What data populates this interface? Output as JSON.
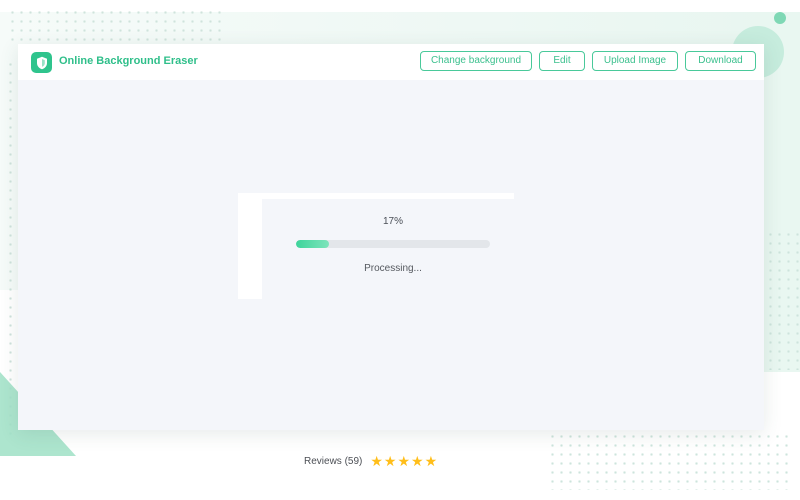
{
  "app": {
    "title": "Online Background Eraser",
    "logo_icon": "shield-icon",
    "accent_color": "#2fc48d"
  },
  "toolbar": {
    "buttons": [
      {
        "label": "Change background"
      },
      {
        "label": "Edit"
      },
      {
        "label": "Upload Image"
      },
      {
        "label": "Download"
      }
    ]
  },
  "progress": {
    "percent_text": "17%",
    "value": 0.17,
    "status": "Processing..."
  },
  "reviews": {
    "label": "Reviews (59)",
    "rating": 5,
    "star_icon": "star-icon",
    "star_color": "#ffbe1a"
  }
}
